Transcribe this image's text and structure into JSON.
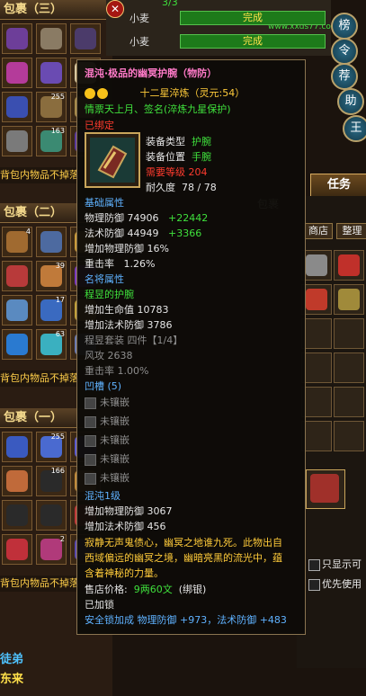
{
  "bags": [
    {
      "title": "包裹（三）"
    },
    {
      "title": "包裹（二）"
    },
    {
      "title": "包裹（一）"
    }
  ],
  "bag_notice": "背包内物品不掉落",
  "bag_counts": [
    "255",
    "163",
    "4",
    "39",
    "17",
    "63",
    "255",
    "166",
    "2"
  ],
  "quest": {
    "counter": "3/3",
    "rows": [
      {
        "name": "小麦",
        "status": "完成"
      },
      {
        "name": "小麦",
        "status": "完成"
      }
    ],
    "watermark": "小富代售www.xxds77.com"
  },
  "right_buttons": [
    "榜",
    "令",
    "荐",
    "助",
    "王"
  ],
  "task_button": "任务",
  "warehouse": {
    "title": "包裹",
    "tab_shop": "商店",
    "tab_sort": "整理"
  },
  "right_options": [
    {
      "label": "只显示可"
    },
    {
      "label": "优先使用"
    }
  ],
  "bottom_left": {
    "line1": "徒弟",
    "line2": "东来"
  },
  "item": {
    "title": "混沌·极品的幽冥护腕（物防）",
    "stars": "十二星淬炼（灵元:54）",
    "engrave": "情票天上月、签名(淬炼九星保护)",
    "bound": "已绑定",
    "type_label": "装备类型",
    "type_value": "护腕",
    "slot_label": "装备位置",
    "slot_value": "手腕",
    "level_label": "需要等级",
    "level_value": "204",
    "dura_label": "耐久度",
    "dura_value": "78 / 78",
    "base_header": "基础属性",
    "base": [
      {
        "label": "物理防御",
        "value": "74906",
        "bonus": "+22442"
      },
      {
        "label": "法术防御",
        "value": "44949",
        "bonus": "+3366"
      },
      {
        "label": "增加物理防御",
        "value": "16%",
        "bonus": ""
      },
      {
        "label": "重击率",
        "value": "1.26%",
        "bonus": ""
      }
    ],
    "famous_header": "名将属性",
    "famous_name": "程昱的护腕",
    "famous": [
      {
        "label": "增加生命值",
        "value": "10783"
      },
      {
        "label": "增加法术防御",
        "value": "3786"
      }
    ],
    "set_line": "程昱套装  四件【1/4】",
    "set_stats": [
      {
        "label": "风攻",
        "value": "2638"
      },
      {
        "label": "重击率",
        "value": "1.00%"
      }
    ],
    "socket_header": "凹槽 (5)",
    "sockets": [
      "未镶嵌",
      "未镶嵌",
      "未镶嵌",
      "未镶嵌",
      "未镶嵌"
    ],
    "chaos_header": "混沌1级",
    "chaos": [
      {
        "label": "增加物理防御",
        "value": "3067"
      },
      {
        "label": "增加法术防御",
        "value": "456"
      }
    ],
    "desc": [
      "寂静无声鬼债心，幽冥之地谁九死。此物出自",
      "西域偏远的幽冥之境，幽暗亮黑的流光中，蕴",
      "含着神秘的力量。"
    ],
    "price_label": "售店价格:",
    "price_value": "9两60文",
    "price_note": "(绑银)",
    "locked": "已加锁",
    "lock_bonus": "安全锁加成  物理防御 +973，法术防御 +483"
  },
  "colors": {
    "title": "#ff7ac8",
    "gold": "#ffcb3a",
    "blue": "#5fb2ff",
    "green": "#3fe03c",
    "red": "#ff3b2e"
  }
}
